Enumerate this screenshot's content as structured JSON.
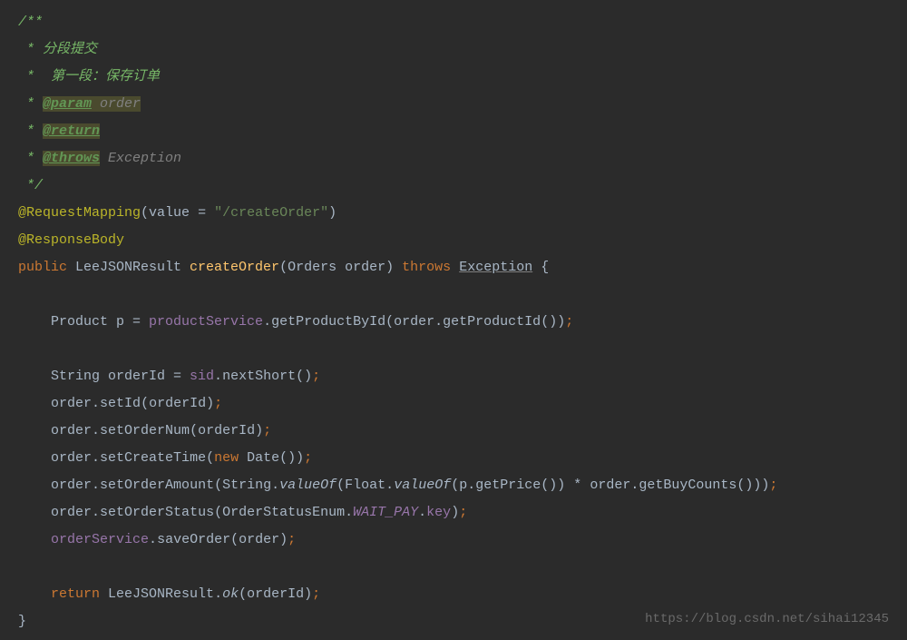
{
  "code": {
    "comment_start": "/**",
    "comment_line1": " * 分段提交",
    "comment_line2": " *  第一段：保存订单",
    "comment_star": " * ",
    "tag_param": "@param",
    "param_name": " order",
    "tag_return": "@return",
    "tag_throws": "@throws",
    "throws_type": " Exception",
    "comment_end": " */",
    "annotation_requestmapping": "@RequestMapping",
    "value_attr": "value",
    "equals": " = ",
    "url_string": "\"/createOrder\"",
    "annotation_responsebody": "@ResponseBody",
    "kw_public": "public",
    "return_type": " LeeJSONResult ",
    "method_name": "createOrder",
    "param_type": "Orders ",
    "param_var": "order",
    "kw_throws": "throws",
    "exception_type": "Exception",
    "brace_open": " {",
    "line_product": "    Product p = ",
    "productService": "productService",
    "dot": ".",
    "getProductById": "getProductById",
    "order_var": "order",
    "getProductId": "getProductId",
    "line_string_orderid": "    String orderId = ",
    "sid": "sid",
    "nextShort": "nextShort",
    "indent": "    ",
    "setId": "setId",
    "orderId_var": "orderId",
    "setOrderNum": "setOrderNum",
    "setCreateTime": "setCreateTime",
    "kw_new": "new",
    "date_type": " Date",
    "setOrderAmount": "setOrderAmount",
    "string_type": "String",
    "valueOf": "valueOf",
    "float_type": "Float",
    "p_var": "p",
    "getPrice": "getPrice",
    "mult": " * ",
    "getBuyCounts": "getBuyCounts",
    "setOrderStatus": "setOrderStatus",
    "orderStatusEnum": "OrderStatusEnum",
    "wait_pay": "WAIT_PAY",
    "key_field": "key",
    "orderService": "orderService",
    "saveOrder": "saveOrder",
    "kw_return": "return",
    "leeJsonResult": " LeeJSONResult",
    "ok_method": "ok",
    "brace_close": "}",
    "open_paren": "(",
    "close_paren": ")",
    "close_paren2": "()",
    "semi": ";",
    "space": " "
  },
  "watermark": "https://blog.csdn.net/sihai12345"
}
